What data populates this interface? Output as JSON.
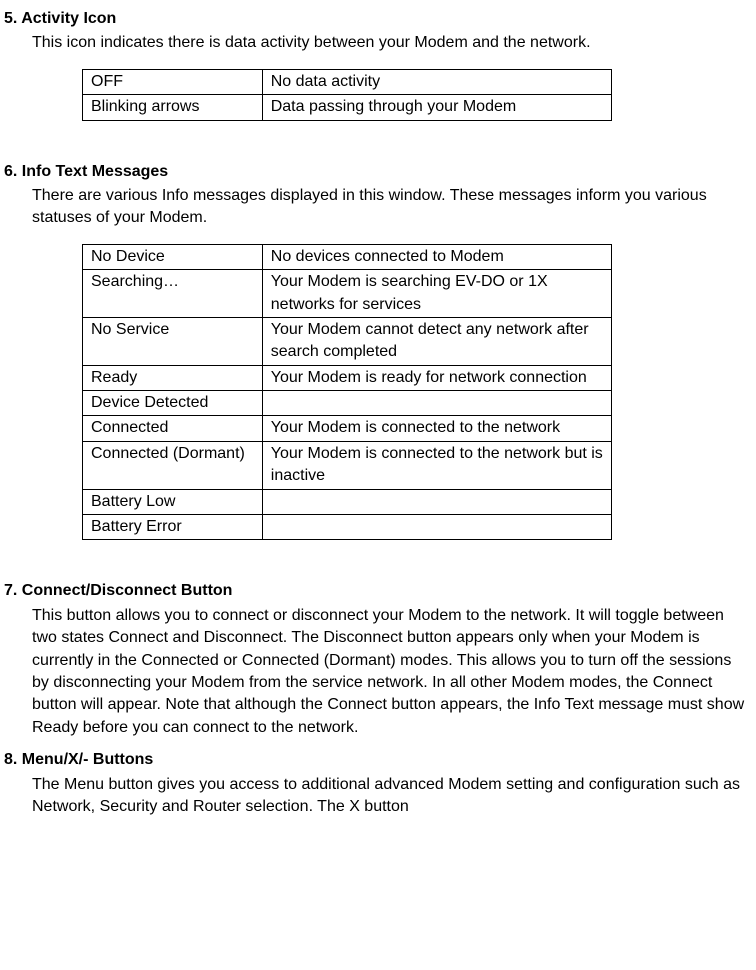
{
  "section5": {
    "heading": "5. Activity Icon",
    "text": "This icon indicates there is data activity between your Modem and the network.",
    "table": [
      {
        "c1": "OFF",
        "c2": "No data activity"
      },
      {
        "c1": "Blinking arrows",
        "c2": "Data passing through your Modem"
      }
    ]
  },
  "section6": {
    "heading": "6. Info Text Messages",
    "text": "There are various Info messages displayed in this window. These messages inform you various statuses of your Modem.",
    "table": [
      {
        "c1": "No Device",
        "c2": "No devices connected to Modem"
      },
      {
        "c1": "Searching…",
        "c2": "Your Modem is searching EV-DO or 1X networks for services"
      },
      {
        "c1": "No Service",
        "c2": "Your Modem cannot detect any network after search completed"
      },
      {
        "c1": "Ready",
        "c2": "Your Modem is ready for network connection"
      },
      {
        "c1": "Device Detected",
        "c2": ""
      },
      {
        "c1": "Connected",
        "c2": "Your Modem is connected to the network"
      },
      {
        "c1": "Connected (Dormant)",
        "c2": "Your Modem is connected to the network but is inactive"
      },
      {
        "c1": "Battery Low",
        "c2": ""
      },
      {
        "c1": "Battery Error",
        "c2": ""
      }
    ]
  },
  "section7": {
    "heading": "7. Connect/Disconnect Button",
    "text": "This button allows you to connect or disconnect your Modem to the network. It will toggle between two states Connect and Disconnect. The Disconnect button appears only when your Modem is currently in the Connected or Connected (Dormant) modes. This allows you to turn off the sessions by disconnecting your Modem from the service network. In all other Modem modes, the Connect button will appear. Note that although the Connect button appears, the Info Text message must show Ready before you can connect to the network."
  },
  "section8": {
    "heading": "8. Menu/X/- Buttons",
    "text": "The Menu button gives you access to additional advanced Modem setting and configuration such as Network, Security and Router selection. The X button"
  }
}
